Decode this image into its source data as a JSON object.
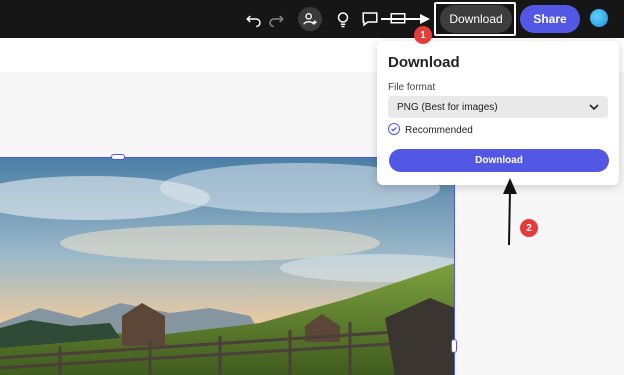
{
  "toolbar": {
    "download_label": "Download",
    "share_label": "Share",
    "icons": [
      "undo-icon",
      "redo-icon",
      "add-user-icon",
      "lightbulb-icon",
      "comment-icon",
      "present-icon"
    ]
  },
  "download_panel": {
    "title": "Download",
    "file_format_label": "File format",
    "file_format_value": "PNG (Best for images)",
    "recommended_label": "Recommended",
    "download_button_label": "Download"
  },
  "annotations": {
    "step1": "1",
    "step2": "2"
  },
  "colors": {
    "accent": "#5258e4",
    "topbar": "#161616",
    "badge": "#e53b3b"
  }
}
